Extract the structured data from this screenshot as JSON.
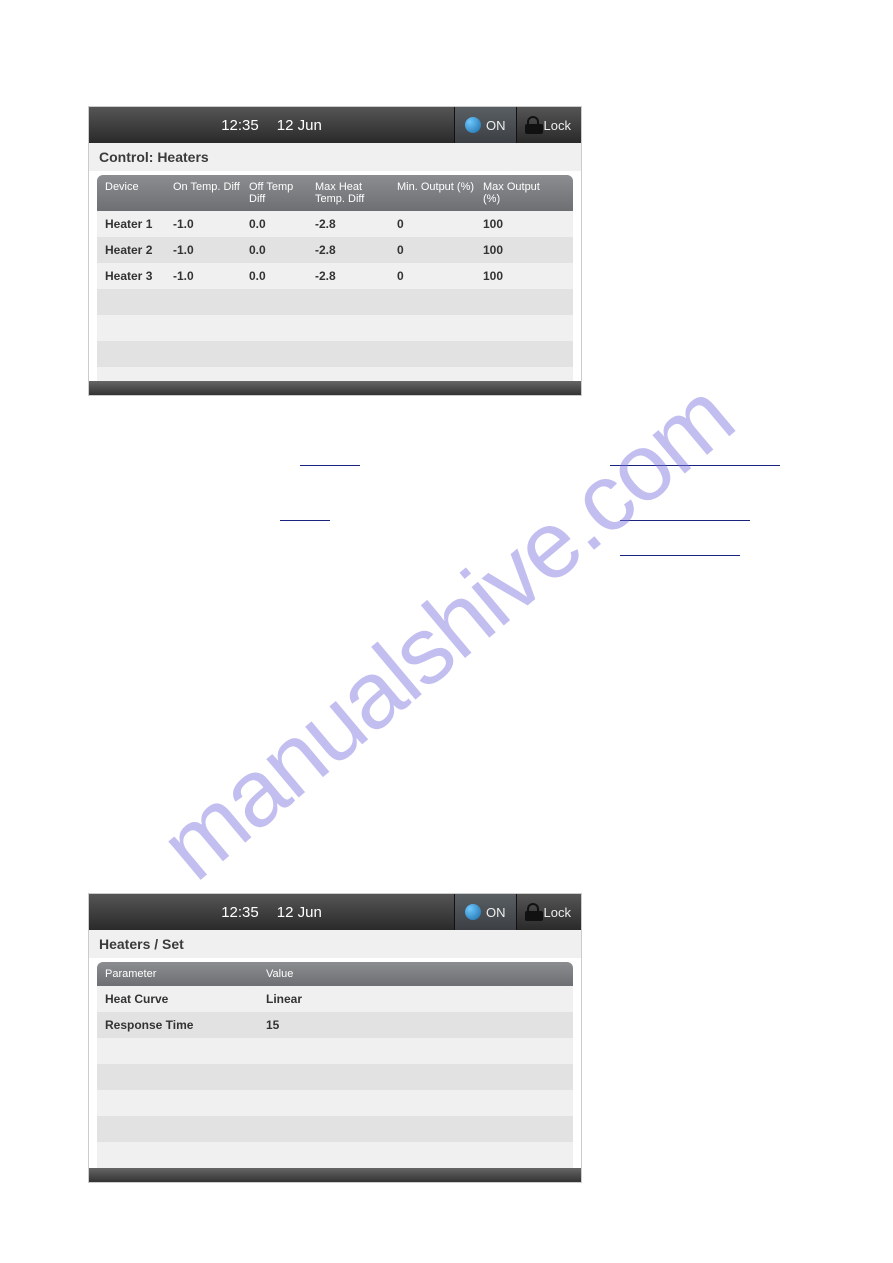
{
  "watermark": "manualshive.com",
  "topbar": {
    "time": "12:35",
    "date": "12 Jun",
    "on_label": "ON",
    "lock_label": "Lock"
  },
  "panel1": {
    "title": "Control: Heaters",
    "headers": {
      "device": "Device",
      "on_temp": "On Temp. Diff",
      "off_temp": "Off Temp Diff",
      "max_heat": "Max Heat Temp. Diff",
      "min_out": "Min. Output (%)",
      "max_out": "Max Output (%)"
    },
    "rows": [
      {
        "device": "Heater 1",
        "on_temp": "-1.0",
        "off_temp": "0.0",
        "max_heat": "-2.8",
        "min_out": "0",
        "max_out": "100"
      },
      {
        "device": "Heater 2",
        "on_temp": "-1.0",
        "off_temp": "0.0",
        "max_heat": "-2.8",
        "min_out": "0",
        "max_out": "100"
      },
      {
        "device": "Heater 3",
        "on_temp": "-1.0",
        "off_temp": "0.0",
        "max_heat": "-2.8",
        "min_out": "0",
        "max_out": "100"
      }
    ]
  },
  "panel2": {
    "title": "Heaters / Set",
    "headers": {
      "parameter": "Parameter",
      "value": "Value"
    },
    "rows": [
      {
        "parameter": "Heat Curve",
        "value": "Linear"
      },
      {
        "parameter": "Response Time",
        "value": "15"
      }
    ]
  }
}
